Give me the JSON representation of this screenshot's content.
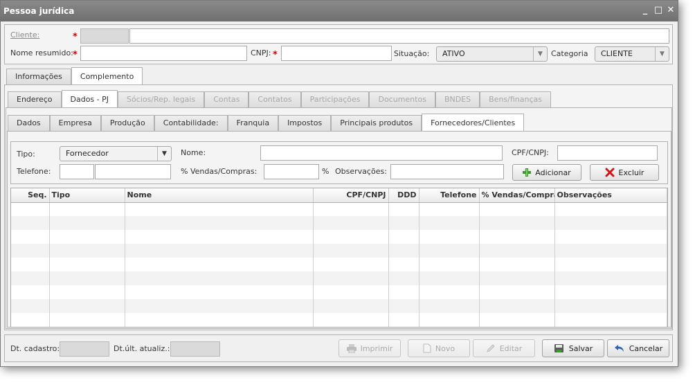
{
  "window": {
    "title": "Pessoa jurídica",
    "minimize": "_",
    "maximize": "□",
    "close": "✕"
  },
  "header": {
    "cliente_label": "Cliente:",
    "cliente_code": "",
    "cliente_name": "",
    "nome_resumido_label": "Nome resumido:",
    "nome_resumido_value": "",
    "cnpj_label": "CNPJ:",
    "cnpj_value": "",
    "situacao_label": "Situação:",
    "situacao_value": "ATIVO",
    "categoria_label": "Categoria",
    "categoria_value": "CLIENTE",
    "required_mark": "*"
  },
  "main_tabs": [
    {
      "label": "Informações",
      "active": false
    },
    {
      "label": "Complemento",
      "active": true
    }
  ],
  "sub_tabs": [
    {
      "label": "Endereço",
      "state": "normal"
    },
    {
      "label": "Dados - PJ",
      "state": "active"
    },
    {
      "label": "Sócios/Rep. legais",
      "state": "disabled"
    },
    {
      "label": "Contas",
      "state": "disabled"
    },
    {
      "label": "Contatos",
      "state": "disabled"
    },
    {
      "label": "Participações",
      "state": "disabled"
    },
    {
      "label": "Documentos",
      "state": "disabled"
    },
    {
      "label": "BNDES",
      "state": "disabled"
    },
    {
      "label": "Bens/finanças",
      "state": "disabled"
    }
  ],
  "pj_tabs": [
    {
      "label": "Dados",
      "active": false
    },
    {
      "label": "Empresa",
      "active": false
    },
    {
      "label": "Produção",
      "active": false
    },
    {
      "label": "Contabilidade:",
      "active": false
    },
    {
      "label": "Franquia",
      "active": false
    },
    {
      "label": "Impostos",
      "active": false
    },
    {
      "label": "Principais produtos",
      "active": false
    },
    {
      "label": "Fornecedores/Clientes",
      "active": true
    }
  ],
  "form": {
    "tipo_label": "Tipo:",
    "tipo_value": "Fornecedor",
    "nome_label": "Nome:",
    "nome_value": "",
    "cpfcnpj_label": "CPF/CNPJ:",
    "cpfcnpj_value": "",
    "telefone_label": "Telefone:",
    "ddd_value": "",
    "telefone_value": "",
    "vendas_label": "% Vendas/Compras:",
    "vendas_value": "",
    "percent_sign": "%",
    "obs_label": "Observações:",
    "obs_value": "",
    "adicionar_label": "Adicionar",
    "excluir_label": "Excluir"
  },
  "grid": {
    "columns": [
      "Seq.",
      "Tipo",
      "Nome",
      "CPF/CNPJ",
      "DDD",
      "Telefone",
      "% Vendas/Compras",
      "Observações"
    ],
    "rows": []
  },
  "footer": {
    "dt_cadastro_label": "Dt. cadastro:",
    "dt_cadastro_value": "",
    "dt_atualiz_label": "Dt.últ. atualiz.:",
    "dt_atualiz_value": "",
    "imprimir_label": "Imprimir",
    "novo_label": "Novo",
    "editar_label": "Editar",
    "salvar_label": "Salvar",
    "cancelar_label": "Cancelar"
  },
  "colors": {
    "required": "#dd0000",
    "add_icon": "#3a9a2a",
    "delete_icon": "#d01515",
    "titlebar": "#7a7a7a"
  }
}
